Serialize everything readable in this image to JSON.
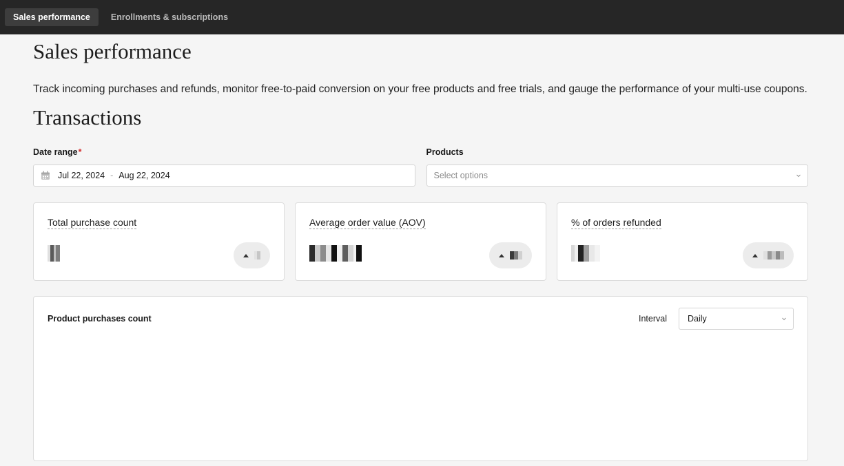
{
  "tabs": [
    {
      "label": "Sales performance"
    },
    {
      "label": "Enrollments & subscriptions"
    }
  ],
  "page": {
    "title": "Sales performance",
    "description": "Track incoming purchases and refunds, monitor free-to-paid conversion on your free products and free trials, and gauge the performance of your multi-use coupons."
  },
  "transactions": {
    "title": "Transactions",
    "date_range": {
      "label": "Date range",
      "required_mark": "*",
      "start": "Jul 22, 2024",
      "separator": "-",
      "end": "Aug 22, 2024"
    },
    "products": {
      "label": "Products",
      "placeholder": "Select options"
    }
  },
  "metrics": [
    {
      "title": "Total purchase count"
    },
    {
      "title": "Average order value (AOV)"
    },
    {
      "title": "% of orders refunded"
    }
  ],
  "chart": {
    "title": "Product purchases count",
    "interval_label": "Interval",
    "interval_value": "Daily"
  },
  "icons": {
    "calendar": "calendar-icon",
    "dropdown": "chevron-down-icon",
    "trend": "triangle-up-icon"
  },
  "colors": {
    "topbar": "#262626",
    "active_tab": "#3d3d3d",
    "required": "#d32f2f",
    "background": "#f5f5f5"
  }
}
